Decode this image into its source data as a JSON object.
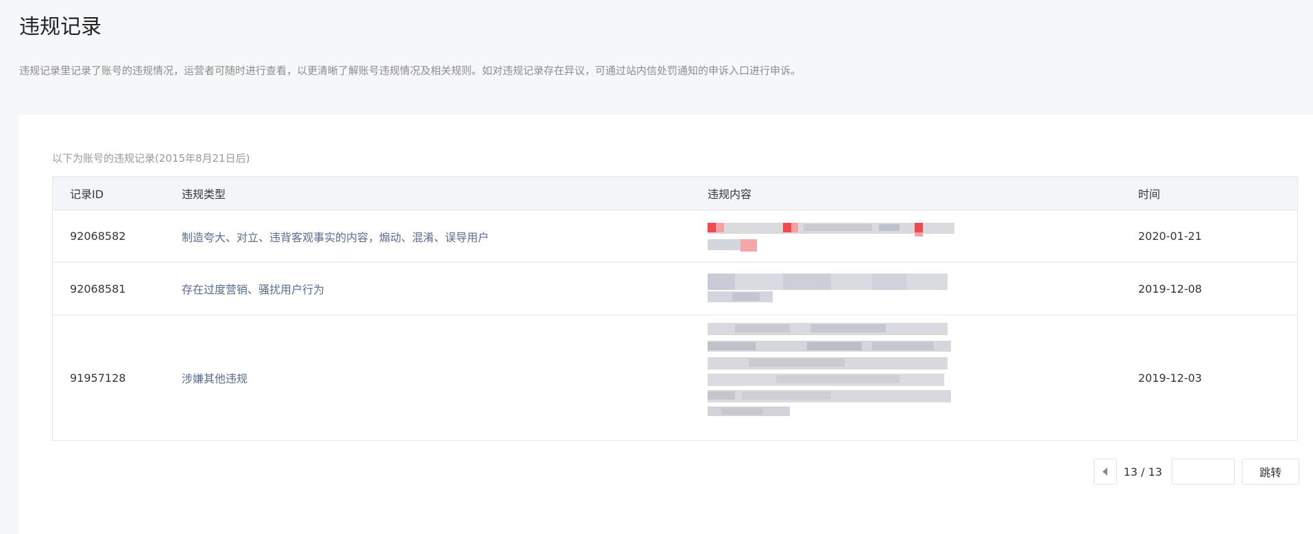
{
  "page": {
    "title": "违规记录",
    "description": "违规记录里记录了账号的违规情况，运营者可随时进行查看，以更清晰了解账号违规情况及相关规则。如对违规记录存在异议，可通过站内信处罚通知的申诉入口进行申诉。"
  },
  "panel": {
    "intro": "以下为账号的违规记录(2015年8月21日后)"
  },
  "table": {
    "headers": [
      "记录ID",
      "违规类型",
      "违规内容",
      "时间"
    ],
    "rows": [
      {
        "id": "92068582",
        "type": "制造夸大、对立、违背客观事实的内容，煽动、混淆、误导用户",
        "time": "2020-01-21"
      },
      {
        "id": "92068581",
        "type": "存在过度营销、骚扰用户行为",
        "time": "2019-12-08"
      },
      {
        "id": "91957128",
        "type": "涉嫌其他违规",
        "time": "2019-12-03"
      }
    ]
  },
  "pagination": {
    "current": "13 / 13",
    "jump_value": "",
    "jump_label": "跳转"
  },
  "colors": {
    "link": "#576b95",
    "border": "#e4e6eb",
    "header_bg": "#f4f5f9"
  },
  "icons": {
    "prev": "caret-left-icon"
  }
}
